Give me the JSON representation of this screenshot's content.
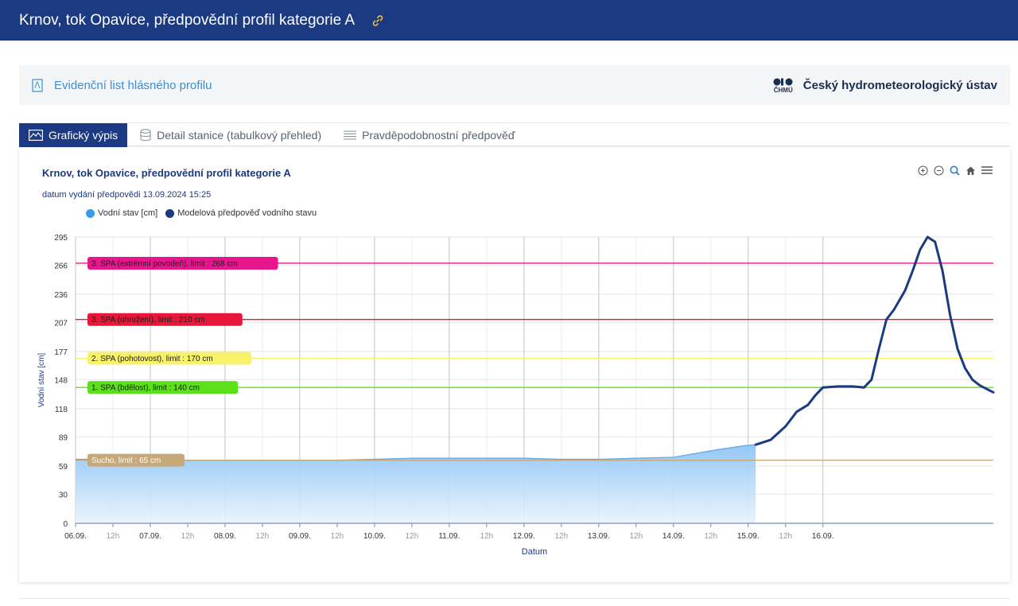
{
  "header": {
    "title": "Krnov, tok Opavice, předpovědní profil kategorie A",
    "icon": "link-icon",
    "bg": "#1b3a82"
  },
  "bar": {
    "link_label": "Evidenční list hlásného profilu",
    "brand_logo_text": "ČHMÚ",
    "brand_name": "Český hydrometeorologický ústav"
  },
  "tabs": [
    {
      "label": "Grafický výpis",
      "icon": "chart-icon",
      "active": true
    },
    {
      "label": "Detail stanice (tabulkový přehled)",
      "icon": "database-icon",
      "active": false
    },
    {
      "label": "Pravděpodobnostní předpověď",
      "icon": "list-icon",
      "active": false
    }
  ],
  "chart_card": {
    "title": "Krnov, tok Opavice, předpovědní profil kategorie A",
    "subtitle": "datum vydání předpovědi 13.09.2024 15:25",
    "toolbar_icons": [
      "zoom-in-icon",
      "zoom-out-icon",
      "magnify-icon",
      "home-icon",
      "menu-icon"
    ]
  },
  "chart_data": {
    "type": "line",
    "xlabel": "Datum",
    "ylabel": "Vodní stav [cm]",
    "ylim": [
      0,
      295
    ],
    "y_ticks": [
      "295",
      "266",
      "236",
      "207",
      "177",
      "148",
      "118",
      "89",
      "59",
      "30",
      "0"
    ],
    "x_ticks": [
      "06.09.",
      "12h",
      "07.09.",
      "12h",
      "08.09.",
      "12h",
      "09.09.",
      "12h",
      "10.09.",
      "12h",
      "11.09.",
      "12h",
      "12.09.",
      "12h",
      "13.09.",
      "12h",
      "14.09.",
      "12h",
      "15.09.",
      "12h",
      "16.09."
    ],
    "legend": [
      {
        "name": "Vodní stav [cm]",
        "color": "#3a9be8"
      },
      {
        "name": "Modelová předpověď vodního stavu",
        "color": "#1b3a82"
      }
    ],
    "thresholds": [
      {
        "label": "3. SPA (extrémní povodeň), limit : 268 cm",
        "value": 268,
        "color": "#e8168c",
        "text_color": "#1a1a1a"
      },
      {
        "label": "3. SPA (ohrožení), limit : 210 cm",
        "value": 210,
        "color": "#e8173a",
        "text_color": "#1a1a1a"
      },
      {
        "label": "2. SPA (pohotovost), limit : 170 cm",
        "value": 170,
        "color": "#f7f26a",
        "text_color": "#1a1a1a"
      },
      {
        "label": "1. SPA (bdělost), limit : 140 cm",
        "value": 140,
        "color": "#5de01c",
        "text_color": "#1a1a1a"
      },
      {
        "label": "Sucho, limit : 65 cm",
        "value": 65,
        "color": "#c7a87a",
        "text_color": "#ffffff"
      }
    ],
    "series": [
      {
        "name": "Vodní stav [cm]",
        "points": [
          [
            0,
            66
          ],
          [
            0.5,
            66
          ],
          [
            1,
            65
          ],
          [
            1.5,
            65
          ],
          [
            2,
            65
          ],
          [
            2.5,
            65
          ],
          [
            3,
            65
          ],
          [
            3.5,
            65
          ],
          [
            4,
            66
          ],
          [
            4.5,
            67
          ],
          [
            5,
            67
          ],
          [
            5.5,
            67
          ],
          [
            6,
            67
          ],
          [
            6.5,
            66
          ],
          [
            7,
            66
          ],
          [
            7.5,
            67
          ],
          [
            8,
            68
          ],
          [
            8.3,
            72
          ],
          [
            8.6,
            76
          ],
          [
            8.95,
            80
          ],
          [
            9.1,
            81
          ]
        ]
      },
      {
        "name": "Modelová předpověď vodního stavu",
        "points": [
          [
            9.1,
            81
          ],
          [
            9.3,
            86
          ],
          [
            9.5,
            100
          ],
          [
            9.65,
            115
          ],
          [
            9.8,
            122
          ],
          [
            9.9,
            132
          ],
          [
            10.0,
            140
          ],
          [
            10.2,
            141
          ],
          [
            10.4,
            141
          ],
          [
            10.55,
            140
          ],
          [
            10.65,
            148
          ],
          [
            10.75,
            180
          ],
          [
            10.85,
            210
          ],
          [
            10.95,
            220
          ],
          [
            11.1,
            240
          ],
          [
            11.2,
            260
          ],
          [
            11.3,
            282
          ],
          [
            11.4,
            295
          ],
          [
            11.5,
            290
          ],
          [
            11.6,
            260
          ],
          [
            11.7,
            215
          ],
          [
            11.8,
            180
          ],
          [
            11.9,
            160
          ],
          [
            12.0,
            148
          ],
          [
            12.1,
            142
          ],
          [
            12.2,
            138
          ],
          [
            12.28,
            135
          ]
        ]
      }
    ]
  }
}
